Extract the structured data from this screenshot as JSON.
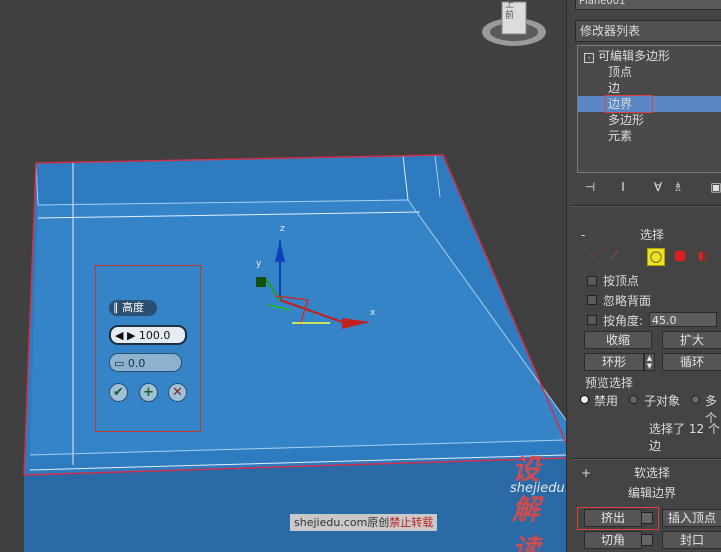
{
  "viewport": {
    "navcube_label": "上\n前",
    "caddy": {
      "title": "高度",
      "value_label": "100.0",
      "value2_label": "0.0",
      "ok_glyph": "✔",
      "add_glyph": "+",
      "cancel_glyph": "✕"
    },
    "gizmo": {
      "x_label": "x",
      "y_label": "y",
      "z_label": "z"
    }
  },
  "watermark": {
    "logo_text": "设解读",
    "domain_text": "shejiedu.com",
    "credit_prefix": "shejiedu.com原创",
    "credit_red": "禁止转载"
  },
  "panel": {
    "object_name": "Plane001",
    "modifier_list_label": "修改器列表",
    "stack": {
      "root": "可编辑多边形",
      "items": [
        "顶点",
        "边",
        "边界",
        "多边形",
        "元素"
      ],
      "selected_index": 2
    },
    "selection": {
      "header": "选择",
      "collapse_glyph": "-",
      "by_vertex": "按顶点",
      "ignore_backfacing": "忽略背面",
      "by_angle": "按角度:",
      "by_angle_value": "45.0",
      "shrink": "收缩",
      "grow": "扩大",
      "ring": "环形",
      "loop": "循环",
      "preview_header": "预览选择",
      "preview_options": [
        "禁用",
        "子对象",
        "多个"
      ],
      "preview_selected": 0,
      "status": "选择了 12 个边"
    },
    "soft_selection": {
      "header": "软选择",
      "collapse_glyph": "+"
    },
    "edit_borders": {
      "header": "编辑边界",
      "extrude": "挤出",
      "insert_vertex": "插入顶点",
      "chamfer": "切角",
      "cap": "封口"
    }
  }
}
